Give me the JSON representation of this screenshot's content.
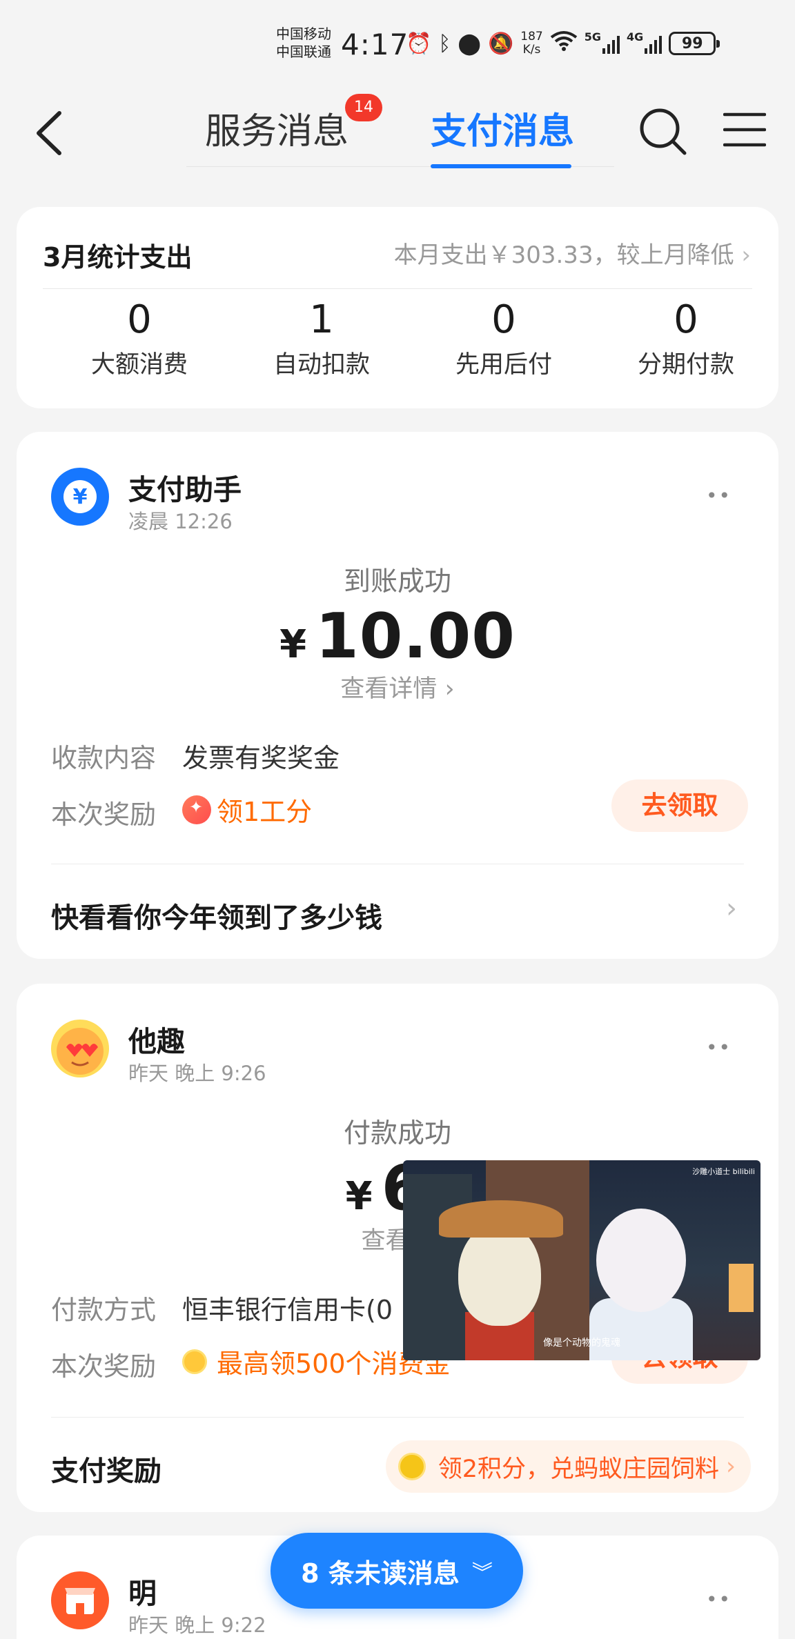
{
  "status_bar": {
    "carrier1": "中国移动",
    "carrier2": "中国联通",
    "time": "4:17",
    "speed_value": "187",
    "speed_unit": "K/s",
    "network1": "5G",
    "network2": "4G",
    "battery": "99"
  },
  "nav": {
    "tab_service": "服务消息",
    "tab_service_badge": "14",
    "tab_payment": "支付消息"
  },
  "summary": {
    "title": "3月统计支出",
    "right_text": "本月支出￥303.33，较上月降低",
    "stats": [
      {
        "value": "0",
        "label": "大额消费"
      },
      {
        "value": "1",
        "label": "自动扣款"
      },
      {
        "value": "0",
        "label": "先用后付"
      },
      {
        "value": "0",
        "label": "分期付款"
      }
    ]
  },
  "messages": [
    {
      "sender": "支付助手",
      "time": "凌晨 12:26",
      "status": "到账成功",
      "currency": "¥",
      "amount": "10.00",
      "detail_link": "查看详情",
      "row1_label": "收款内容",
      "row1_value": "发票有奖奖金",
      "row2_label": "本次奖励",
      "row2_value": "领1工分",
      "claim": "去领取",
      "footer": "快看看你今年领到了多少钱"
    },
    {
      "sender": "他趣",
      "time": "昨天 晚上 9:26",
      "status": "付款成功",
      "currency": "¥",
      "amount": "6.",
      "detail_link": "查看详",
      "row1_label": "付款方式",
      "row1_value": "恒丰银行信用卡(0",
      "row2_label": "本次奖励",
      "row2_value": "最高领500个消费金",
      "claim": "去领取",
      "footer": "支付奖励",
      "footer_pill": "领2积分，兑蚂蚁庄园饲料"
    },
    {
      "sender": "明",
      "time": "昨天 晚上 9:22"
    }
  ],
  "video_overlay": {
    "caption": "像是个动物的鬼魂",
    "watermark": "沙雕小道士 bilibili"
  },
  "unread": {
    "label": "8 条未读消息"
  },
  "colors": {
    "accent_blue": "#1677ff",
    "reward_orange": "#ff5a1f",
    "badge_red": "#f2382a"
  }
}
